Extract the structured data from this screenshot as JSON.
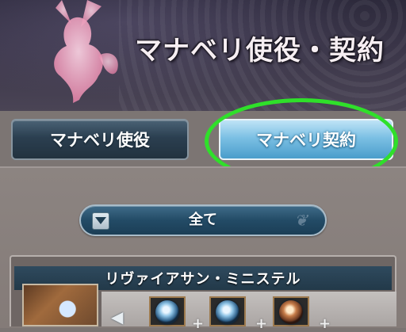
{
  "header": {
    "title": "マナベリ使役・契約"
  },
  "tabs": [
    {
      "label": "マナベリ使役",
      "active": false
    },
    {
      "label": "マナベリ契約",
      "active": true
    }
  ],
  "filter": {
    "label": "全て",
    "icon": "chevron-down-icon"
  },
  "card": {
    "name": "リヴァイアサン・ミニステル",
    "slots": [
      {
        "icon": "water-orb-icon"
      },
      {
        "icon": "water-orb-icon"
      },
      {
        "icon": "fire-orb-icon"
      }
    ]
  },
  "colors": {
    "active_tab": "#7cc0e4",
    "highlight_ring": "#2fe02a",
    "header_bg": "#3b3649"
  }
}
